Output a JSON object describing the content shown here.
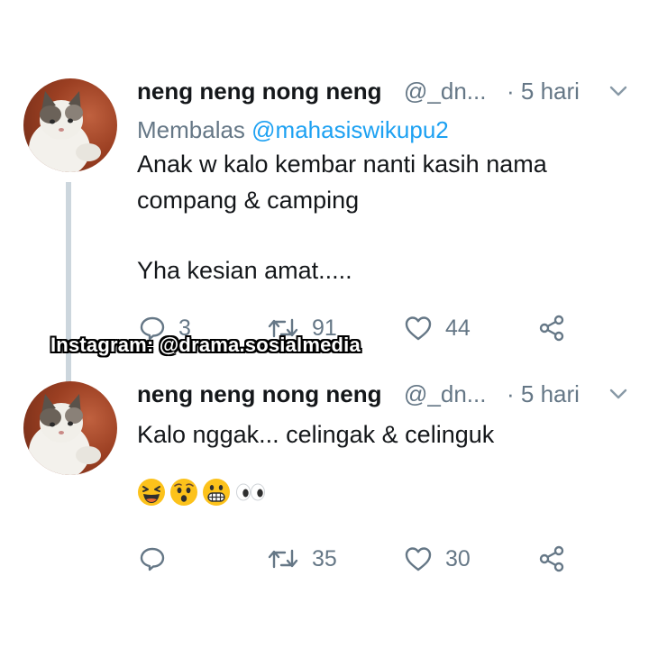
{
  "tweets": [
    {
      "author_name": "neng neng nong neng",
      "handle": "@_dn...",
      "time": "· 5 hari",
      "reply_prefix": "Membalas ",
      "reply_mention": "@mahasiswikupu2",
      "text_line1": "Anak w kalo kembar nanti kasih nama",
      "text_line2": "compang & camping",
      "text_line3": "Yha kesian amat.....",
      "reply_count": "3",
      "retweet_count": "91",
      "like_count": "44"
    },
    {
      "author_name": "neng neng nong neng",
      "handle": "@_dn...",
      "time": "· 5 hari",
      "text_line1": "Kalo nggak... celingak & celinguk",
      "emojis": [
        "laughing-squint-emoji",
        "hushed-face-emoji",
        "grimacing-face-emoji",
        "eyes-emoji"
      ],
      "reply_count": "",
      "retweet_count": "35",
      "like_count": "30"
    }
  ],
  "watermark": "Instagram: @drama.sosialmedia",
  "icons": [
    "reply-icon",
    "retweet-icon",
    "like-icon",
    "share-icon",
    "chevron-down-icon"
  ],
  "colors": {
    "text_primary": "#14171a",
    "text_secondary": "#657786",
    "mention": "#1da1f2",
    "thread_line": "#ccd6dd"
  }
}
